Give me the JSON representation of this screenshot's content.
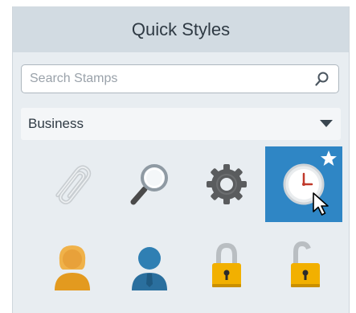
{
  "panel": {
    "title": "Quick Styles"
  },
  "search": {
    "placeholder": "Search Stamps",
    "icon": "search-icon"
  },
  "category": {
    "selected": "Business",
    "icon": "chevron-down-icon"
  },
  "stamps": [
    {
      "icon": "paperclip-icon",
      "selected": false
    },
    {
      "icon": "magnifier-icon",
      "selected": false
    },
    {
      "icon": "gear-icon",
      "selected": false
    },
    {
      "icon": "clock-icon",
      "selected": true,
      "favorite_icon": "star-icon"
    },
    {
      "icon": "person-female-icon",
      "selected": false
    },
    {
      "icon": "person-male-icon",
      "selected": false
    },
    {
      "icon": "lock-closed-icon",
      "selected": false
    },
    {
      "icon": "lock-open-icon",
      "selected": false
    }
  ],
  "colors": {
    "header_bg": "#d2dbe2",
    "panel_bg": "#e8edf1",
    "selected_bg": "#2f86c5",
    "lock_gold": "#f2b000"
  }
}
